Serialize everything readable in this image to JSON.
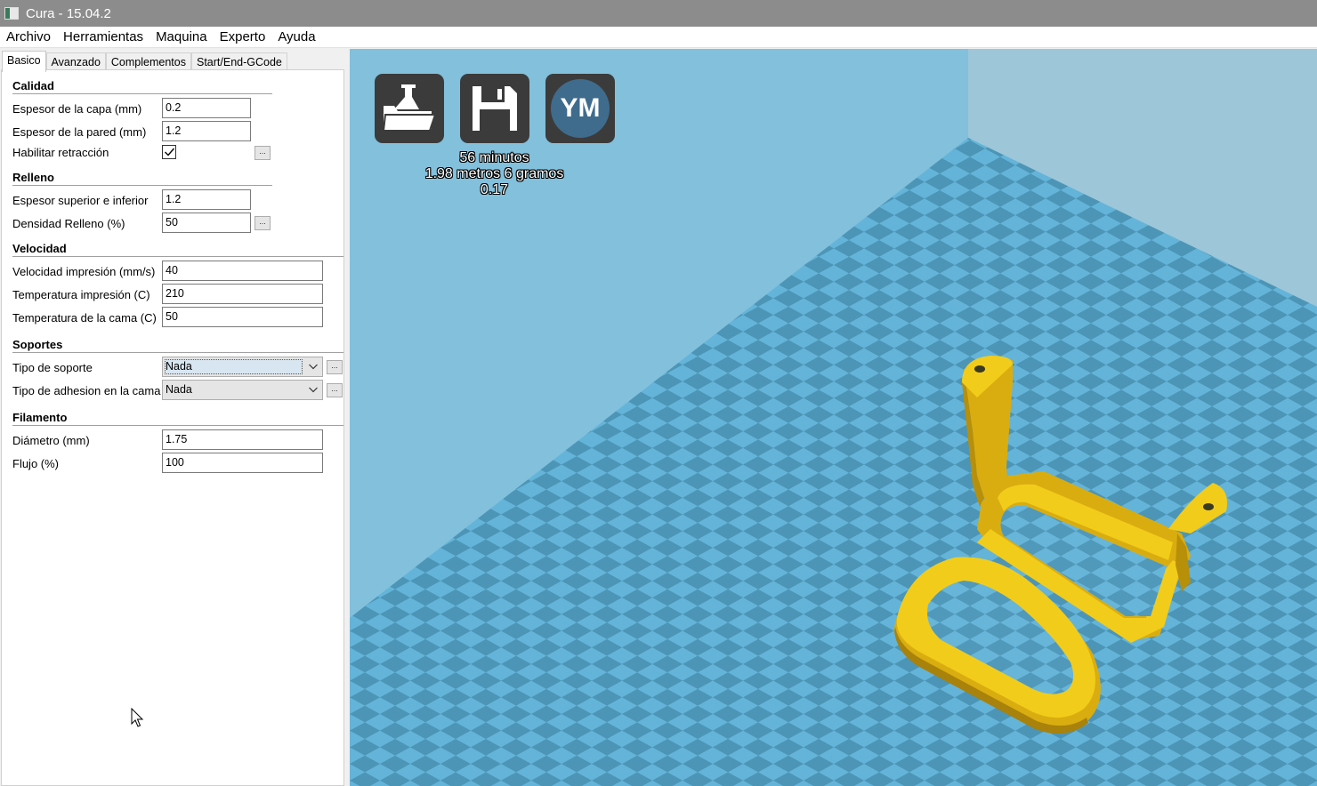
{
  "window": {
    "title": "Cura - 15.04.2"
  },
  "menu": [
    "Archivo",
    "Herramientas",
    "Maquina",
    "Experto",
    "Ayuda"
  ],
  "tabs": [
    "Basico",
    "Avanzado",
    "Complementos",
    "Start/End-GCode"
  ],
  "sections": {
    "calidad": {
      "title": "Calidad",
      "layer_height": {
        "label": "Espesor de la capa (mm)",
        "value": "0.2"
      },
      "wall_thickness": {
        "label": "Espesor de la pared (mm)",
        "value": "1.2"
      },
      "retraction": {
        "label": "Habilitar retracción",
        "checked": true,
        "more": "..."
      }
    },
    "relleno": {
      "title": "Relleno",
      "top_bottom": {
        "label": "Espesor superior e inferior",
        "value": "1.2"
      },
      "density": {
        "label": "Densidad Relleno (%)",
        "value": "50",
        "more": "..."
      }
    },
    "velocidad": {
      "title": "Velocidad",
      "print_speed": {
        "label": "Velocidad impresión (mm/s)",
        "value": "40"
      },
      "print_temp": {
        "label": "Temperatura impresión (C)",
        "value": "210"
      },
      "bed_temp": {
        "label": "Temperatura de la cama (C)",
        "value": "50"
      }
    },
    "soportes": {
      "title": "Soportes",
      "support_type": {
        "label": "Tipo de soporte",
        "value": "Nada",
        "more": "..."
      },
      "adhesion_type": {
        "label": "Tipo de adhesion en la cama",
        "value": "Nada",
        "more": "..."
      }
    },
    "filamento": {
      "title": "Filamento",
      "diameter": {
        "label": "Diámetro (mm)",
        "value": "1.75"
      },
      "flow": {
        "label": "Flujo (%)",
        "value": "100"
      }
    }
  },
  "viewport": {
    "buttons": {
      "load": "folder-load-icon",
      "save": "floppy-save-icon",
      "ym": "YM"
    },
    "print_time": "56 minutos",
    "material": "1.98 metros 6 gramos",
    "cost": "0.17",
    "colors": {
      "background": "#82c0dc",
      "checker_light": "#64b4d9",
      "checker_dark": "#4c95b6",
      "model": "#f2cc1a"
    }
  }
}
